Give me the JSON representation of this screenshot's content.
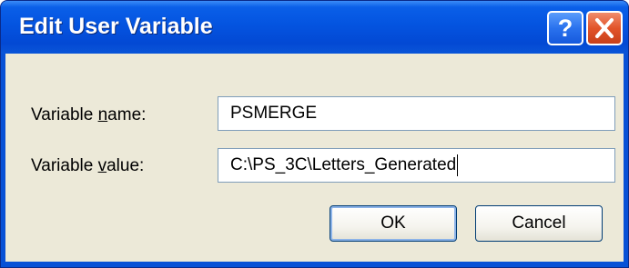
{
  "window": {
    "title": "Edit User Variable",
    "help_label": "?",
    "close_icon": "close-x-icon"
  },
  "form": {
    "name_label_pre": "Variable ",
    "name_label_key": "n",
    "name_label_post": "ame:",
    "name_value": "PSMERGE",
    "value_label_pre": "Variable ",
    "value_label_key": "v",
    "value_label_post": "alue:",
    "value_value": "C:\\PS_3C\\Letters_Generated"
  },
  "buttons": {
    "ok_label": "OK",
    "cancel_label": "Cancel"
  },
  "colors": {
    "titlebar": "#0454e0",
    "dialog_face": "#ece9d8",
    "close_button": "#e2542a",
    "field_border": "#7f9db9"
  }
}
